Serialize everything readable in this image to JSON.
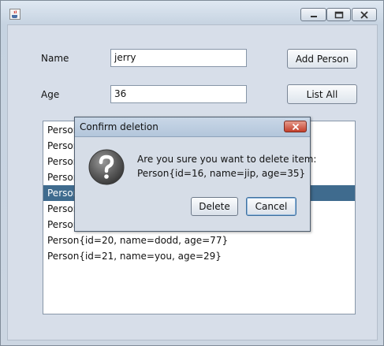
{
  "form": {
    "name_label": "Name",
    "name_value": "jerry",
    "age_label": "Age",
    "age_value": "36",
    "add_button": "Add Person",
    "list_button": "List All"
  },
  "list": {
    "items": [
      "Person",
      "Person",
      "Person",
      "Person",
      "Person",
      "Person",
      "Person",
      "Person{id=20, name=dodd, age=77}",
      "Person{id=21, name=you, age=29}"
    ],
    "selected_index": 4
  },
  "dialog": {
    "title": "Confirm deletion",
    "message_line1": "Are you sure you want to delete item:",
    "message_line2": "Person{id=16, name=jip, age=35}",
    "delete_button": "Delete",
    "cancel_button": "Cancel"
  },
  "icons": {
    "app": "java-cup-icon",
    "minimize": "minimize-icon",
    "maximize": "maximize-icon",
    "close": "close-icon",
    "question": "question-icon"
  },
  "colors": {
    "selection": "#3f6b8e",
    "close_button": "#c4402c"
  }
}
